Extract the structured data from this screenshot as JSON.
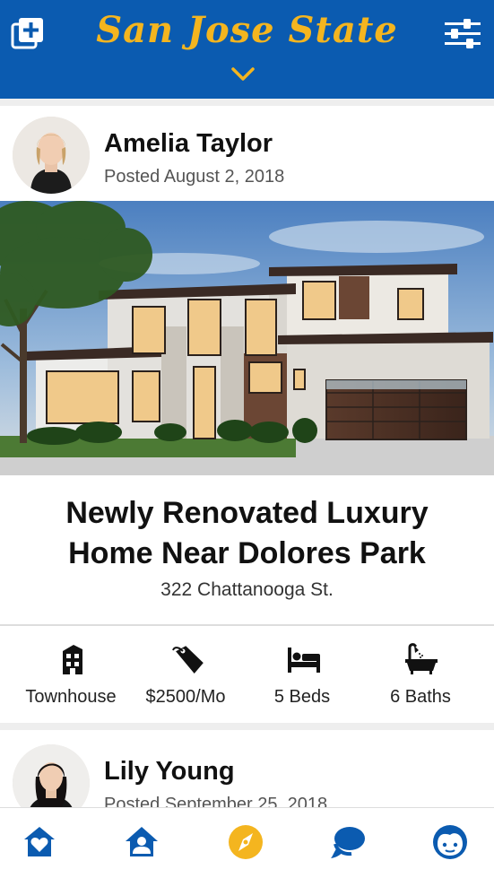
{
  "header": {
    "title": "San Jose State",
    "add_icon": "add-post-icon",
    "filter_icon": "filter-sliders-icon",
    "chevron_icon": "chevron-down-icon"
  },
  "posts": [
    {
      "author": "Amelia Taylor",
      "date": "Posted August 2, 2018",
      "title_line1": "Newly Renovated Luxury",
      "title_line2": "Home Near Dolores Park",
      "address": "322 Chattanooga St.",
      "stats": [
        {
          "icon": "building-icon",
          "label": "Townhouse"
        },
        {
          "icon": "price-tag-icon",
          "label": "$2500/Mo"
        },
        {
          "icon": "bed-icon",
          "label": "5 Beds"
        },
        {
          "icon": "bathtub-icon",
          "label": "6 Baths"
        }
      ]
    },
    {
      "author": "Lily Young",
      "date": "Posted September 25, 2018"
    }
  ],
  "nav": [
    {
      "icon": "home-heart-icon",
      "active": false
    },
    {
      "icon": "house-person-icon",
      "active": false
    },
    {
      "icon": "compass-icon",
      "active": true
    },
    {
      "icon": "chat-icon",
      "active": false
    },
    {
      "icon": "profile-face-icon",
      "active": false
    }
  ],
  "colors": {
    "brand_blue": "#0b5bb0",
    "brand_gold": "#f4b51f"
  }
}
